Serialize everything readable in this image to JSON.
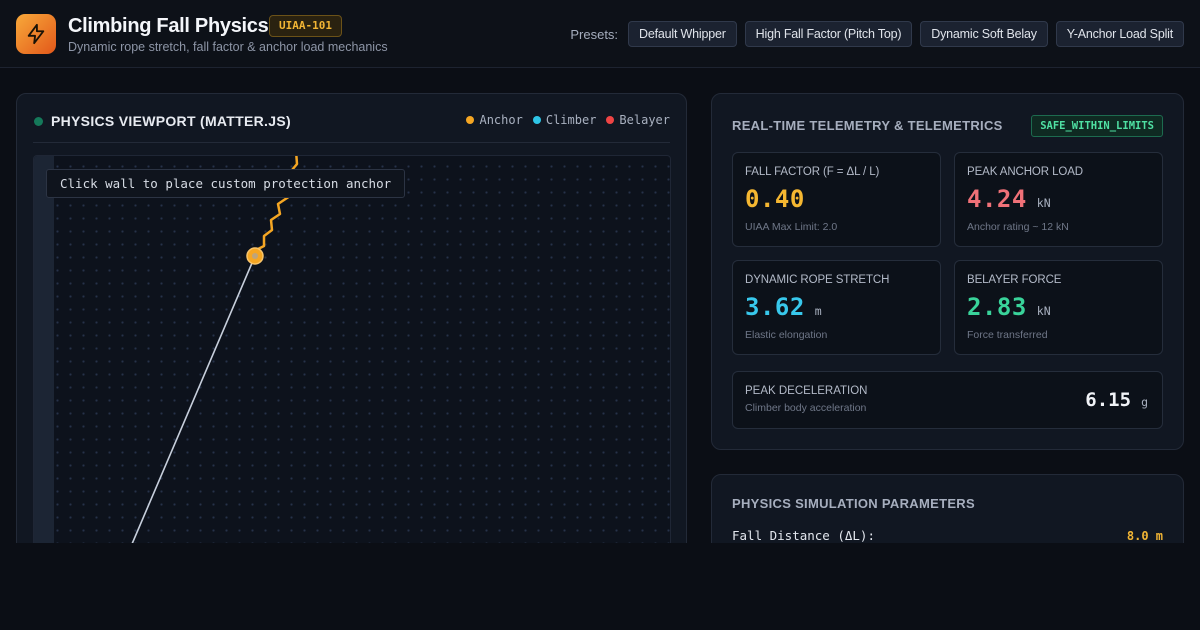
{
  "header": {
    "title": "Climbing Fall Physics",
    "standard_badge": "UIAA-101",
    "subtitle": "Dynamic rope stretch, fall factor & anchor load mechanics",
    "logo_icon": "lightning-bolt-icon",
    "presets_label": "Presets:",
    "presets": [
      "Default Whipper",
      "High Fall Factor (Pitch Top)",
      "Dynamic Soft Belay",
      "Y-Anchor Load Split"
    ]
  },
  "viewport": {
    "title": "PHYSICS VIEWPORT (MATTER.JS)",
    "legend": [
      {
        "label": "Anchor",
        "color": "#f5a623"
      },
      {
        "label": "Climber",
        "color": "#2ec5e6"
      },
      {
        "label": "Belayer",
        "color": "#ef4444"
      }
    ],
    "hint": "Click wall to place custom protection anchor"
  },
  "telemetry": {
    "title": "REAL-TIME TELEMETRY & TELEMETRICS",
    "status": "SAFE_WITHIN_LIMITS",
    "cards": [
      {
        "label": "FALL FACTOR (F = ΔL / L)",
        "value": "0.40",
        "unit": "",
        "note": "UIAA Max Limit: 2.0",
        "color": "#f5b731"
      },
      {
        "label": "PEAK ANCHOR LOAD",
        "value": "4.24",
        "unit": "kN",
        "note": "Anchor rating ~ 12 kN",
        "color": "#f07178"
      },
      {
        "label": "DYNAMIC ROPE STRETCH",
        "value": "3.62",
        "unit": "m",
        "note": "Elastic elongation",
        "color": "#38c8ec"
      },
      {
        "label": "BELAYER FORCE",
        "value": "2.83",
        "unit": "kN",
        "note": "Force transferred",
        "color": "#39d39a"
      }
    ],
    "decel": {
      "label": "PEAK DECELERATION",
      "note": "Climber body acceleration",
      "value": "6.15",
      "unit": "g"
    }
  },
  "params": {
    "title": "PHYSICS SIMULATION PARAMETERS",
    "fall_label": "Fall Distance (ΔL):",
    "fall_value": "8.0 m"
  }
}
